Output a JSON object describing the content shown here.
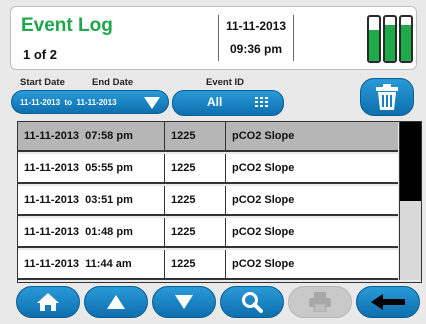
{
  "header": {
    "title": "Event Log",
    "page_indicator": "1 of 2",
    "date": "11-11-2013",
    "time": "09:36 pm",
    "battery_levels": [
      0.7,
      0.82,
      0.82
    ],
    "accent_color": "#1ea84a"
  },
  "filters": {
    "start_date_label": "Start Date",
    "end_date_label": "End Date",
    "date_range_value": "11-11-2013  to  11-11-2013",
    "event_id_label": "Event ID",
    "event_id_value": "All"
  },
  "table": {
    "rows": [
      {
        "datetime": "11-11-2013  07:58 pm",
        "id": "1225",
        "event": "pCO2 Slope",
        "selected": true
      },
      {
        "datetime": "11-11-2013  05:55 pm",
        "id": "1225",
        "event": "pCO2 Slope",
        "selected": false
      },
      {
        "datetime": "11-11-2013  03:51 pm",
        "id": "1225",
        "event": "pCO2 Slope",
        "selected": false
      },
      {
        "datetime": "11-11-2013  01:48 pm",
        "id": "1225",
        "event": "pCO2 Slope",
        "selected": false
      },
      {
        "datetime": "11-11-2013  11:44 am",
        "id": "1225",
        "event": "pCO2 Slope",
        "selected": false
      }
    ],
    "scroll_position": 0.0,
    "scroll_visible_fraction": 0.5
  },
  "toolbar": {
    "buttons": [
      "home-icon",
      "up-arrow-icon",
      "down-arrow-icon",
      "search-icon",
      "print-icon",
      "back-arrow-icon"
    ]
  }
}
